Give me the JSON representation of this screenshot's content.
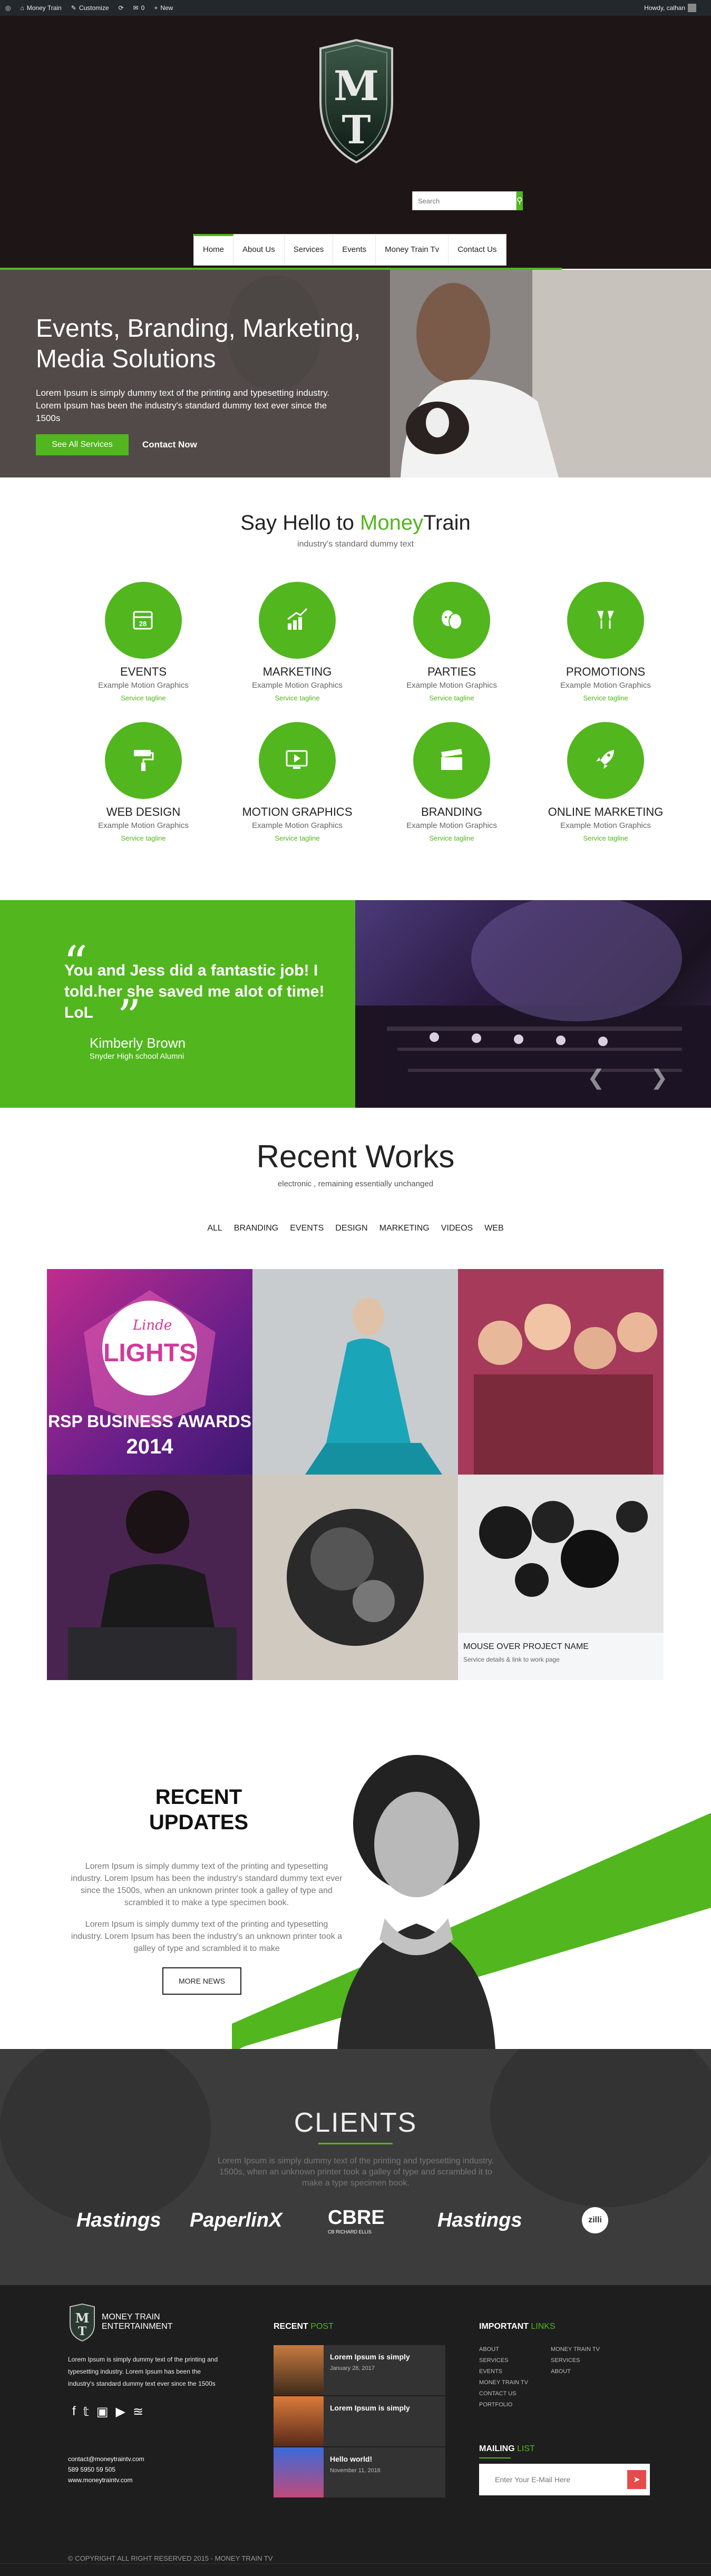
{
  "adminbar": {
    "site": "Money Train",
    "customize": "Customize",
    "comments": "0",
    "new": "New",
    "howdy": "Howdy, calhan"
  },
  "search": {
    "placeholder": "Search"
  },
  "nav": [
    "Home",
    "About Us",
    "Services",
    "Events",
    "Money Train Tv",
    "Contact Us"
  ],
  "hero": {
    "title": "Events, Branding, Marketing, Media Solutions",
    "text": "Lorem Ipsum is simply dummy text of the printing and typesetting industry. Lorem Ipsum has been the industry's standard dummy text ever since the 1500s",
    "btn_primary": "See All Services",
    "btn_secondary": "Contact Now"
  },
  "intro": {
    "title_a": "Say Hello to ",
    "title_b": "Money",
    "title_c": "Train",
    "subtitle": "industry's standard dummy text"
  },
  "services": [
    {
      "title": "EVENTS",
      "desc": "Example Motion Graphics",
      "tag": "Service tagline",
      "icon": "calendar-icon"
    },
    {
      "title": "MARKETING",
      "desc": "Example Motion Graphics",
      "tag": "Service tagline",
      "icon": "chart-icon"
    },
    {
      "title": "PARTIES",
      "desc": "Example Motion Graphics",
      "tag": "Service tagline",
      "icon": "masks-icon"
    },
    {
      "title": "PROMOTIONS",
      "desc": "Example Motion Graphics",
      "tag": "Service tagline",
      "icon": "glasses-icon"
    },
    {
      "title": "WEB DESIGN",
      "desc": "Example Motion Graphics",
      "tag": "Service tagline",
      "icon": "paint-roller-icon"
    },
    {
      "title": "MOTION GRAPHICS",
      "desc": "Example Motion Graphics",
      "tag": "Service tagline",
      "icon": "screen-icon"
    },
    {
      "title": "BRANDING",
      "desc": "Example Motion Graphics",
      "tag": "Service tagline",
      "icon": "clapper-icon"
    },
    {
      "title": "ONLINE MARKETING",
      "desc": "Example Motion Graphics",
      "tag": "Service tagline",
      "icon": "rocket-icon"
    }
  ],
  "testimonial": {
    "quote": "You and Jess did a fantastic job! I told.her she saved me alot of time! LoL",
    "name": "Kimberly Brown",
    "org": "Snyder High school Alumni"
  },
  "works": {
    "title": "Recent Works",
    "subtitle": "electronic , remaining essentially unchanged",
    "filters": [
      "ALL",
      "BRANDING",
      "EVENTS",
      "DESIGN",
      "MARKETING",
      "VIDEOS",
      "WEB"
    ],
    "award_line1": "Linde",
    "award_line2": "LIGHTS",
    "award_line3": "RSP BUSINESS AWARDS",
    "award_year": "2014",
    "hover_title": "MOUSE OVER PROJECT NAME",
    "hover_sub": "Service details & link to work page"
  },
  "updates": {
    "title": "RECENT UPDATES",
    "p1": "Lorem Ipsum is simply dummy text of the printing and typesetting industry. Lorem Ipsum has been the industry's standard dummy text ever since the 1500s, when an unknown printer took a galley of type and scrambled it to make a type specimen book.",
    "p2": "Lorem Ipsum is simply dummy text of the printing and typesetting industry. Lorem Ipsum has been the industry's an unknown printer took a galley of type and scrambled it to make",
    "button": "MORE NEWS"
  },
  "clients": {
    "title": "CLIENTS",
    "text": "Lorem Ipsum is simply dummy text of the printing and typesetting industry. 1500s, when an unknown printer took a galley of type and scrambled it to make a type specimen book.",
    "logos": [
      "Hastings",
      "PaperlinX",
      "CBRE",
      "Hastings",
      "zilli"
    ],
    "cbre_sub": "CB RICHARD ELLIS"
  },
  "footer": {
    "brand_line1": "MONEY TRAIN",
    "brand_line2": "ENTERTAINMENT",
    "about": "Lorem Ipsum is simply dummy text of the printing and typesetting industry. Lorem Ipsum has been the industry's standard dummy text ever since the 1500s",
    "email": "contact@moneytraintv.com",
    "phone": "589 5950 59 505",
    "website": "www.moneytraintv.com",
    "recent_a": "RECENT ",
    "recent_b": "POST",
    "posts": [
      {
        "title": "Lorem Ipsum is simply",
        "date": "January 28, 2017"
      },
      {
        "title": "Lorem Ipsum is simply",
        "date": ""
      },
      {
        "title": "Hello world!",
        "date": "November 11, 2016"
      }
    ],
    "links_a": "IMPORTANT ",
    "links_b": "LINKS",
    "links_col1": [
      "ABOUT",
      "SERVICES",
      "EVENTS",
      "MONEY TRAIN TV",
      "CONTACT US",
      "PORTFOLIO"
    ],
    "links_col2": [
      "MONEY TRAIN TV",
      "SERVICES",
      "ABOUT"
    ],
    "mailing_a": "MAILING ",
    "mailing_b": "LIST",
    "mail_placeholder": "Enter Your E-Mail Here",
    "copyright": "© COPYRIGHT ALL RIGHT RESERVED 2015 - MONEY TRAIN TV"
  },
  "colors": {
    "accent": "#52b61e",
    "dark": "#1e1516",
    "footer": "#1e1e1e"
  }
}
